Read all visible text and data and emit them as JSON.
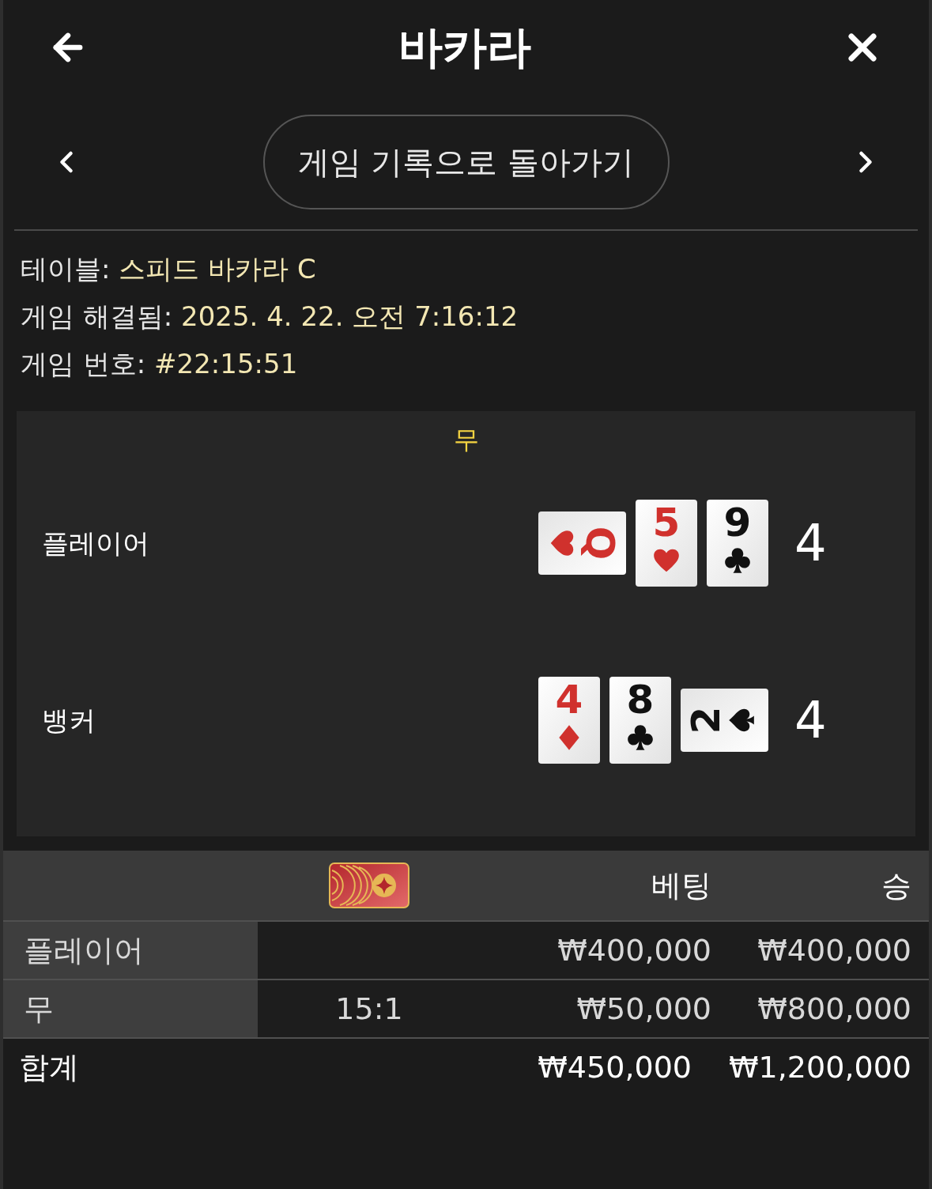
{
  "header": {
    "title": "바카라"
  },
  "nav": {
    "button": "게임 기록으로 돌아가기"
  },
  "info": [
    {
      "label": "테이블:",
      "value": "스피드 바카라 C"
    },
    {
      "label": "게임 해결됨:",
      "value": "2025. 4. 22. 오전 7:16:12"
    },
    {
      "label": "게임 번호:",
      "value": "#22:15:51"
    }
  ],
  "result": {
    "outcome": "무",
    "hands": [
      {
        "name": "플레이어",
        "score": "4",
        "cards": [
          {
            "rank": "Q",
            "kind": "hearts",
            "rotated": true
          },
          {
            "rank": "5",
            "kind": "hearts",
            "rotated": false
          },
          {
            "rank": "9",
            "kind": "clubs",
            "rotated": false
          }
        ]
      },
      {
        "name": "뱅커",
        "score": "4",
        "cards": [
          {
            "rank": "4",
            "kind": "diamonds",
            "rotated": false
          },
          {
            "rank": "8",
            "kind": "clubs",
            "rotated": false
          },
          {
            "rank": "2",
            "kind": "spades",
            "rotated": true
          }
        ]
      }
    ]
  },
  "bets": {
    "columns": [
      "베팅",
      "승"
    ],
    "rows": [
      {
        "label": "플레이어",
        "bet": "₩400,000",
        "win": "₩400,000"
      },
      {
        "label": "무",
        "odds": "15:1",
        "bet": "₩50,000",
        "win": "₩800,000"
      }
    ],
    "total": {
      "label": "합계",
      "bet": "₩450,000",
      "win": "₩1,200,000"
    }
  }
}
